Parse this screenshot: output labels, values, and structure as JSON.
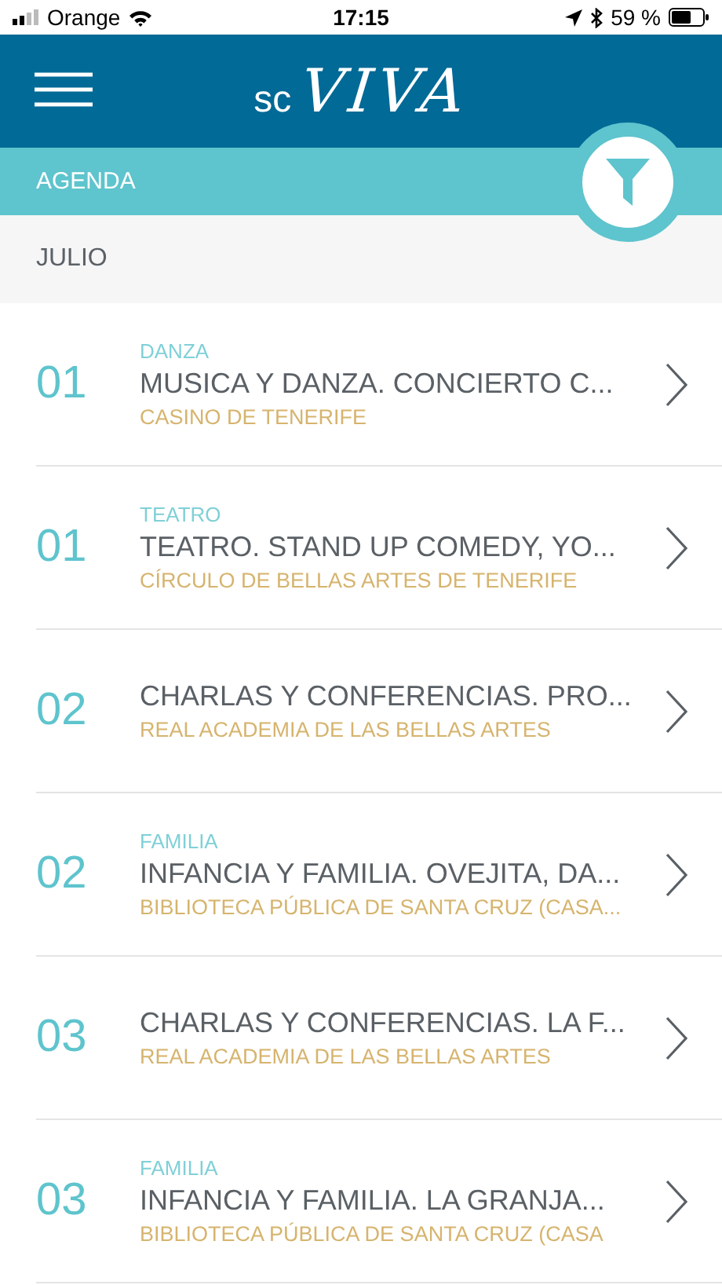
{
  "status_bar": {
    "carrier": "Orange",
    "time": "17:15",
    "battery": "59 %"
  },
  "header": {
    "logo_prefix": "sc",
    "logo_name": "VIVA"
  },
  "section_bar": {
    "title": "AGENDA"
  },
  "month": "JULIO",
  "events": [
    {
      "day": "01",
      "category": "DANZA",
      "title": "MUSICA Y DANZA. CONCIERTO C...",
      "venue": "CASINO DE TENERIFE"
    },
    {
      "day": "01",
      "category": "TEATRO",
      "title": "TEATRO. STAND UP COMEDY, YO...",
      "venue": "CÍRCULO DE BELLAS ARTES DE TENERIFE"
    },
    {
      "day": "02",
      "title": "CHARLAS Y CONFERENCIAS. PRO...",
      "venue": "REAL ACADEMIA DE LAS BELLAS ARTES"
    },
    {
      "day": "02",
      "category": "FAMILIA",
      "title": "INFANCIA Y FAMILIA. OVEJITA, DA...",
      "venue": "BIBLIOTECA PÚBLICA DE SANTA CRUZ (CASA..."
    },
    {
      "day": "03",
      "title": "CHARLAS Y CONFERENCIAS. LA F...",
      "venue": "REAL ACADEMIA DE LAS BELLAS ARTES"
    },
    {
      "day": "03",
      "category": "FAMILIA",
      "title": "INFANCIA Y FAMILIA. LA GRANJA...",
      "venue": "BIBLIOTECA PÚBLICA DE SANTA CRUZ (CASA"
    }
  ]
}
